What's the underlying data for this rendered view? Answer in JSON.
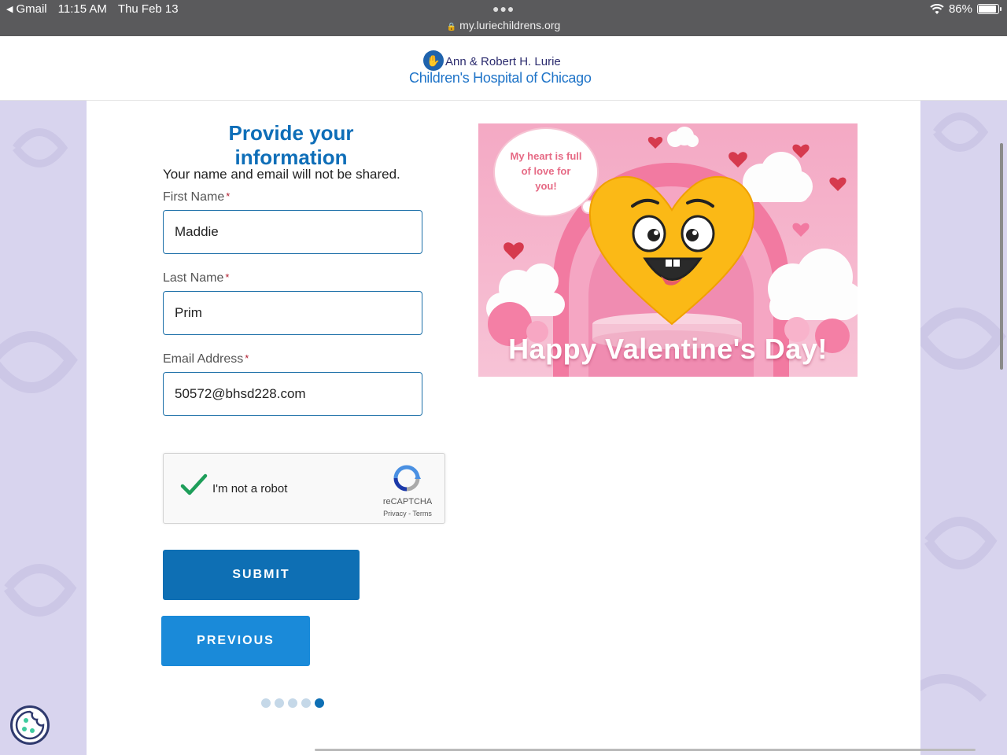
{
  "status_bar": {
    "back_app": "Gmail",
    "time": "11:15 AM",
    "date": "Thu Feb 13",
    "url": "my.luriechildrens.org",
    "battery": "86%",
    "battery_level": 0.86
  },
  "header": {
    "logo_line1": "Ann & Robert H. Lurie",
    "logo_line2": "Children's Hospital of Chicago"
  },
  "form": {
    "title": "Provide your information",
    "privacy_note": "Your name and email will not be shared.",
    "required_marker": "*",
    "first_name": {
      "label": "First Name",
      "value": "Maddie"
    },
    "last_name": {
      "label": "Last Name",
      "value": "Prim"
    },
    "email": {
      "label": "Email Address",
      "value": "50572@bhsd228.com"
    },
    "captcha": {
      "label": "I'm not a robot",
      "brand": "reCAPTCHA",
      "links": "Privacy - Terms",
      "checked": true
    },
    "submit_label": "SUBMIT",
    "previous_label": "PREVIOUS",
    "pager": {
      "total": 5,
      "current": 5
    }
  },
  "card_image": {
    "bubble_text": "My heart is full of love for you!",
    "greeting": "Happy Valentine's Day!"
  },
  "colors": {
    "accent": "#0e6fb4",
    "secondary_button": "#1a8ad9",
    "title": "#0e6eb8",
    "side_bg": "#d8d4ee"
  }
}
